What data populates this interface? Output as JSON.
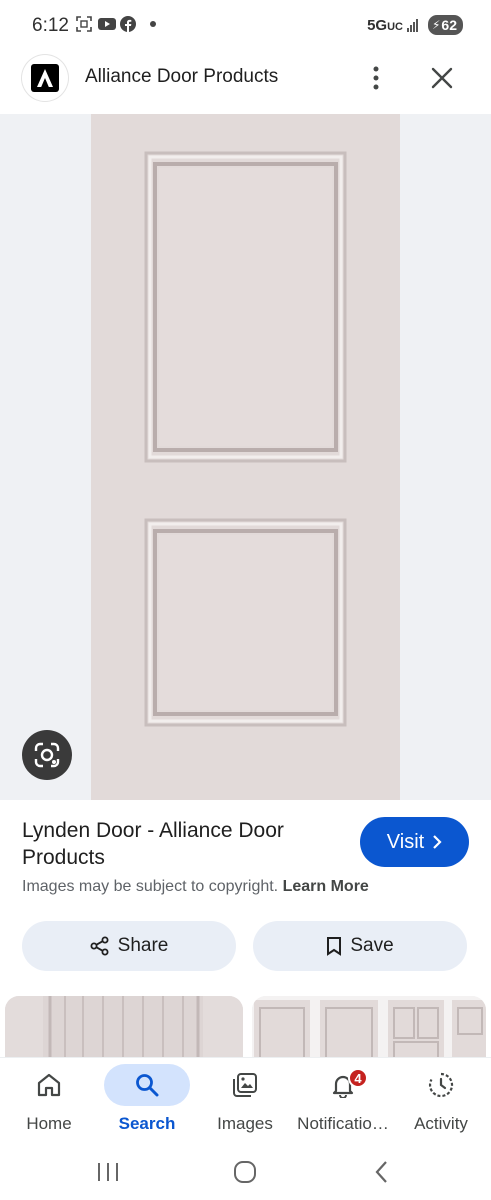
{
  "status_bar": {
    "time": "6:12",
    "network": "5G",
    "network_sub": "UC",
    "battery": "62",
    "notification_icons": [
      "screenshot-icon",
      "youtube-icon",
      "facebook-icon"
    ]
  },
  "header": {
    "logo_letter": "A",
    "site_name": "Alliance Door Products",
    "more_icon": "more-vertical-icon",
    "close_icon": "close-icon"
  },
  "image_viewer": {
    "background": "#eff1f4",
    "door_color": "#e2dad9",
    "lens_icon": "google-lens-icon"
  },
  "result": {
    "title": "Lynden Door - Alliance Door Products",
    "visit_label": "Visit",
    "copyright_notice": "Images may be subject to copyright.",
    "learn_more": "Learn More",
    "share_label": "Share",
    "save_label": "Save"
  },
  "colors": {
    "accent": "#0b57d0",
    "active_pill": "#d3e3fd",
    "action_button": "#e9eef6",
    "badge": "#c5221f"
  },
  "bottom_nav": {
    "items": [
      {
        "label": "Home",
        "icon": "home-icon",
        "active": false
      },
      {
        "label": "Search",
        "icon": "search-icon",
        "active": true
      },
      {
        "label": "Images",
        "icon": "images-icon",
        "active": false
      },
      {
        "label": "Notificatio…",
        "icon": "bell-icon",
        "active": false,
        "badge": "4"
      },
      {
        "label": "Activity",
        "icon": "activity-icon",
        "active": false
      }
    ]
  },
  "system_nav": {
    "recents_icon": "recents-icon",
    "home_icon": "home-circle-icon",
    "back_icon": "back-icon"
  }
}
